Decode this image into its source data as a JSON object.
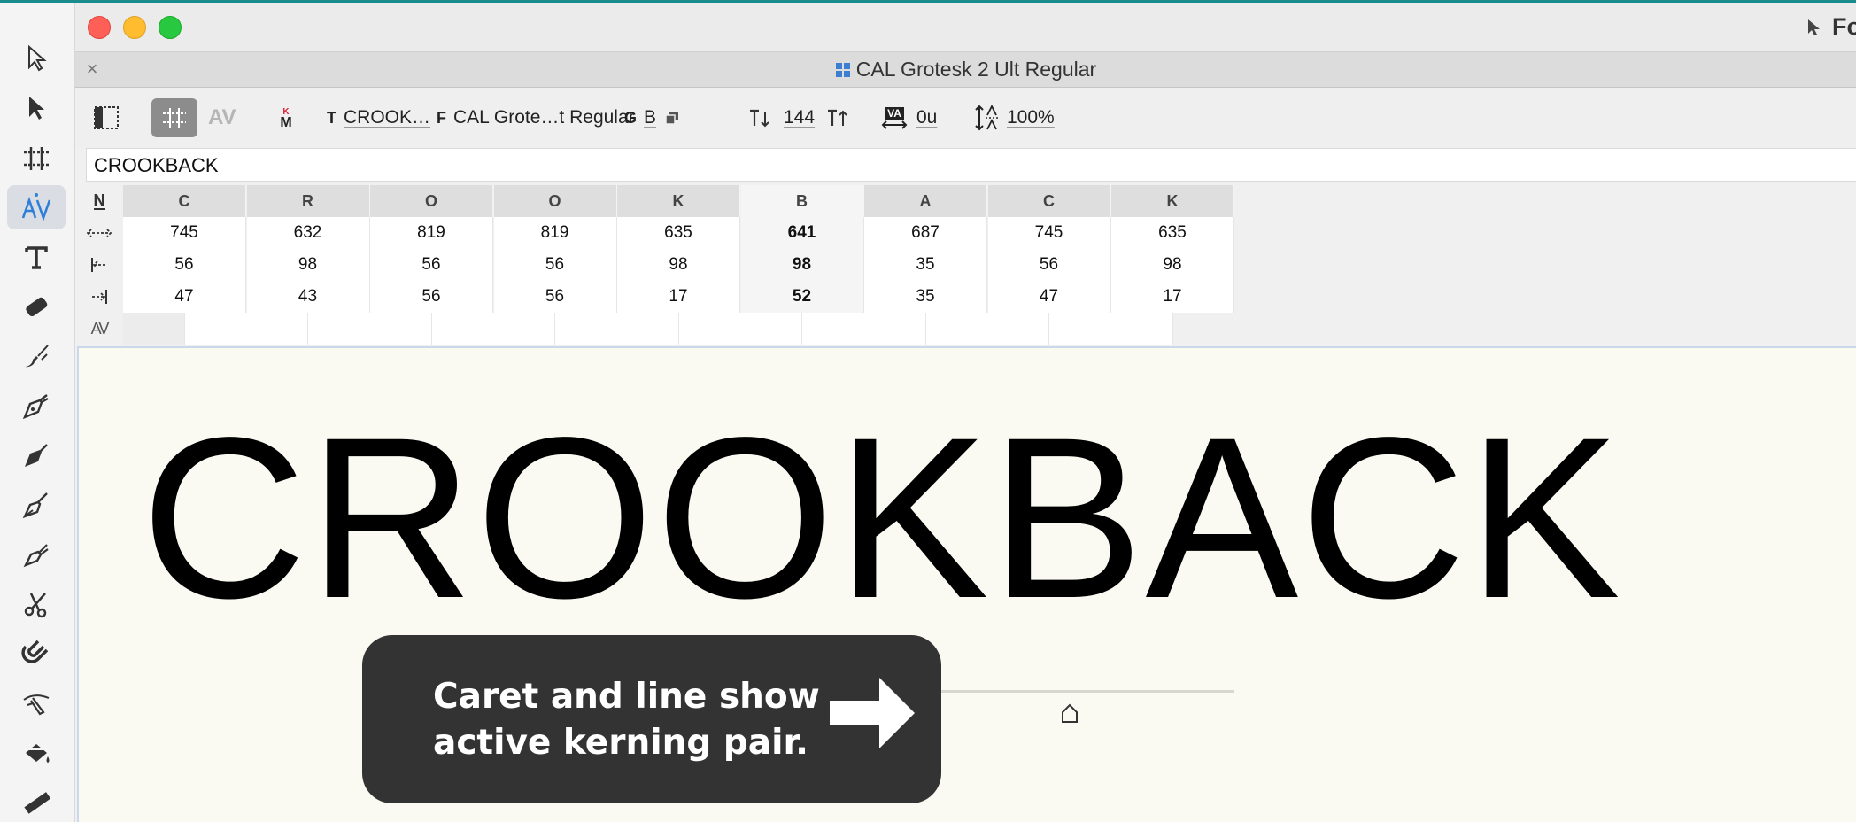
{
  "window": {
    "title": "CAL Grotesk 2 Ult Regular",
    "right_title": "Fo",
    "close_label": "×"
  },
  "toolbar": {
    "text_label": "T",
    "text_value": "CROOK…",
    "font_label": "F",
    "font_value": "CAL Grote…t Regular",
    "glyph_label": "G",
    "glyph_value": "B",
    "size_value": "144",
    "tracking_label": "VA",
    "tracking_value": "0u",
    "line_height_value": "100%",
    "kerning_av": "AV",
    "kern_m": "M",
    "kern_k": "K"
  },
  "text_field": {
    "value": "CROOKBACK"
  },
  "metrics": {
    "header_icon": "N",
    "glyphs": [
      "C",
      "R",
      "O",
      "O",
      "K",
      "B",
      "A",
      "C",
      "K"
    ],
    "selected_index": 5,
    "widths": [
      "745",
      "632",
      "819",
      "819",
      "635",
      "641",
      "687",
      "745",
      "635"
    ],
    "lsb": [
      "56",
      "98",
      "56",
      "56",
      "98",
      "98",
      "35",
      "56",
      "98"
    ],
    "rsb": [
      "47",
      "43",
      "56",
      "56",
      "17",
      "52",
      "35",
      "47",
      "17"
    ],
    "kern_row_icon": "AV"
  },
  "canvas": {
    "sample_text": "CROOKBACK"
  },
  "callout": {
    "text": "Caret and line show active kerning pair."
  },
  "icons": {
    "tools": [
      "pointer-icon",
      "node-pointer-icon",
      "metrics-tool-icon",
      "kerning-tool-icon",
      "text-tool-icon",
      "eraser-icon",
      "brush-icon",
      "pen-icon",
      "power-pen-icon",
      "rapid-pen-icon",
      "corner-pen-icon",
      "scissors-icon",
      "magnet-icon",
      "knife-icon",
      "fill-icon",
      "ruler-icon"
    ]
  },
  "colors": {
    "accent_blue": "#2f7fd8",
    "callout_bg": "#333333",
    "selected_header": "#bfbfbf",
    "canvas_bg": "#fafaf3"
  }
}
